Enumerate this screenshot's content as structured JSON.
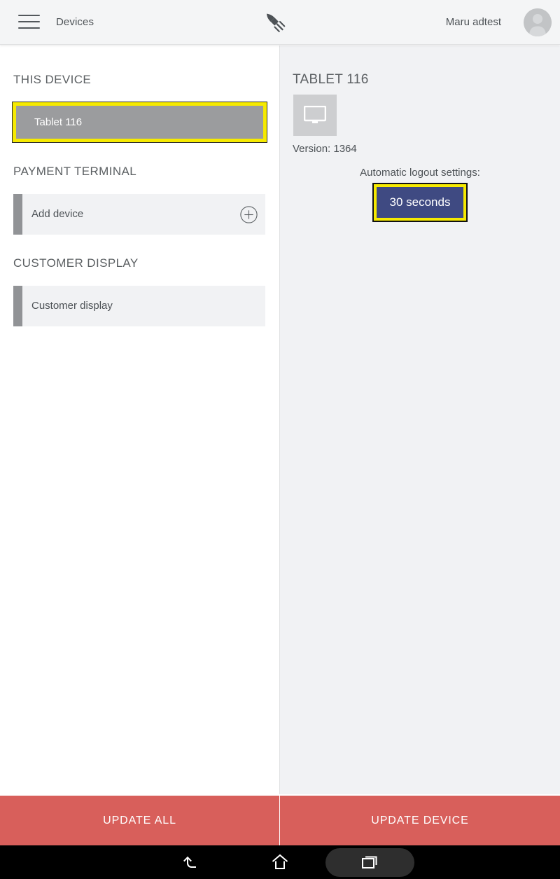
{
  "header": {
    "menu_icon": "hamburger-menu-icon",
    "title": "Devices",
    "logo_icon": "fork-knife-rocket-logo-icon",
    "user_name": "Maru adtest",
    "avatar_icon": "user-avatar-icon"
  },
  "sidebar": {
    "sections": [
      {
        "heading": "THIS DEVICE",
        "items": [
          {
            "label": "Tablet 116",
            "selected": true
          }
        ]
      },
      {
        "heading": "PAYMENT TERMINAL",
        "items": [
          {
            "label": "Add device",
            "action_icon": "plus-circle-icon"
          }
        ]
      },
      {
        "heading": "CUSTOMER DISPLAY",
        "items": [
          {
            "label": "Customer display"
          }
        ]
      }
    ]
  },
  "detail": {
    "title": "TABLET 116",
    "thumbnail_icon": "monitor-display-icon",
    "version": "Version: 1364",
    "logout_label": "Automatic logout settings:",
    "logout_value": "30 seconds"
  },
  "actions": {
    "update_all": "UPDATE ALL",
    "update_device": "UPDATE DEVICE"
  },
  "navbar": {
    "back": "back-icon",
    "home": "home-icon",
    "recents": "recents-icon"
  },
  "colors": {
    "highlight": "#f6ea00",
    "accent_red": "#d85f5b",
    "logout_blue": "#3f4a82",
    "panel_gray": "#f1f2f4",
    "selected_gray": "#9b9c9e"
  }
}
